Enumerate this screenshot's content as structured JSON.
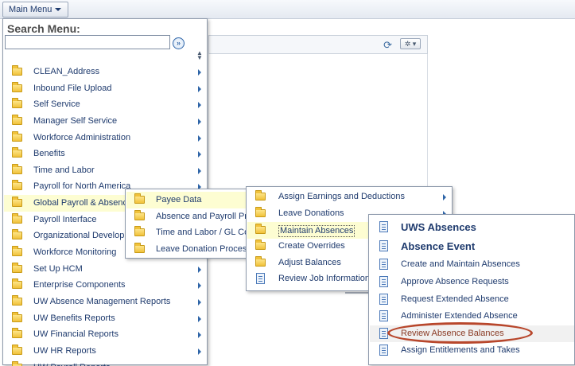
{
  "topbar": {
    "main_menu_label": "Main Menu"
  },
  "search": {
    "label": "Search Menu:",
    "value": "",
    "go_symbol": "»"
  },
  "background": {
    "refresh_symbol": "⟳",
    "gear_symbol": "✲ ▾"
  },
  "menu": {
    "items": [
      {
        "label": "CLEAN_Address",
        "icon": "folder-icon",
        "has_submenu": true
      },
      {
        "label": "Inbound File Upload",
        "icon": "folder-icon",
        "has_submenu": true
      },
      {
        "label": "Self Service",
        "icon": "folder-icon",
        "has_submenu": true
      },
      {
        "label": "Manager Self Service",
        "icon": "folder-icon",
        "has_submenu": true
      },
      {
        "label": "Workforce Administration",
        "icon": "folder-icon",
        "has_submenu": true
      },
      {
        "label": "Benefits",
        "icon": "folder-icon",
        "has_submenu": true
      },
      {
        "label": "Time and Labor",
        "icon": "folder-icon",
        "has_submenu": true
      },
      {
        "label": "Payroll for North America",
        "icon": "folder-icon",
        "has_submenu": true
      },
      {
        "label": "Global Payroll & Absence Mgmt",
        "icon": "folder-icon",
        "has_submenu": true,
        "active": true
      },
      {
        "label": "Payroll Interface",
        "icon": "folder-icon",
        "has_submenu": true
      },
      {
        "label": "Organizational Development",
        "icon": "folder-icon",
        "has_submenu": true
      },
      {
        "label": "Workforce Monitoring",
        "icon": "folder-icon",
        "has_submenu": true
      },
      {
        "label": "Set Up HCM",
        "icon": "folder-icon",
        "has_submenu": true
      },
      {
        "label": "Enterprise Components",
        "icon": "folder-icon",
        "has_submenu": true
      },
      {
        "label": "UW Absence Management Reports",
        "icon": "folder-icon",
        "has_submenu": true
      },
      {
        "label": "UW Benefits Reports",
        "icon": "folder-icon",
        "has_submenu": true
      },
      {
        "label": "UW Financial Reports",
        "icon": "folder-icon",
        "has_submenu": true
      },
      {
        "label": "UW HR Reports",
        "icon": "folder-icon",
        "has_submenu": true
      },
      {
        "label": "UW Payroll Reports",
        "icon": "folder-icon",
        "has_submenu": true
      }
    ]
  },
  "submenu1": {
    "items": [
      {
        "label": "Payee Data",
        "icon": "folder-icon",
        "active": true
      },
      {
        "label": "Absence and Payroll Processing",
        "icon": "folder-icon"
      },
      {
        "label": "Time and Labor / GL Costs",
        "icon": "folder-icon"
      },
      {
        "label": "Leave Donation Process",
        "icon": "folder-icon"
      }
    ]
  },
  "submenu2": {
    "items": [
      {
        "label": "Assign Earnings and Deductions",
        "icon": "folder-icon",
        "has_submenu": true
      },
      {
        "label": "Leave Donations",
        "icon": "folder-icon",
        "has_submenu": true
      },
      {
        "label": "Maintain Absences",
        "icon": "folder-icon",
        "has_submenu": true,
        "active": true
      },
      {
        "label": "Create Overrides",
        "icon": "folder-icon",
        "has_submenu": true
      },
      {
        "label": "Adjust Balances",
        "icon": "folder-icon",
        "has_submenu": true
      },
      {
        "label": "Review Job Information",
        "icon": "document-icon",
        "has_submenu": false
      }
    ]
  },
  "submenu3": {
    "items": [
      {
        "label": "UWS Absences",
        "icon": "document-icon",
        "heading": true
      },
      {
        "label": "Absence Event",
        "icon": "document-icon",
        "heading": true
      },
      {
        "label": "Create and Maintain Absences",
        "icon": "document-icon"
      },
      {
        "label": "Approve Absence Requests",
        "icon": "document-icon"
      },
      {
        "label": "Request Extended Absence",
        "icon": "document-icon"
      },
      {
        "label": "Administer Extended Absence",
        "icon": "document-icon"
      },
      {
        "label": "Review Absence Balances",
        "icon": "document-icon",
        "selected": true
      },
      {
        "label": "Assign Entitlements and Takes",
        "icon": "document-icon"
      }
    ]
  },
  "colors": {
    "menu_text": "#1f3b6e",
    "active_row": "#fdfdd2",
    "highlight_ring": "#b8472c",
    "folder": "#f1c23a"
  }
}
